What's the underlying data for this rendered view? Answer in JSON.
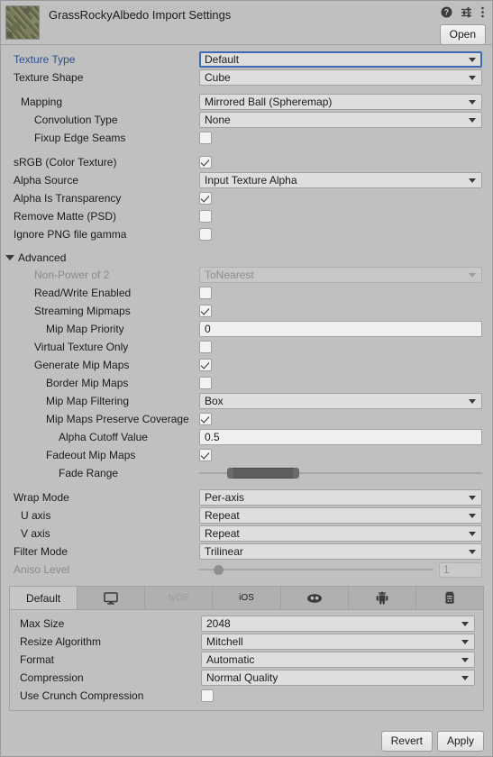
{
  "header": {
    "title": "GrassRockyAlbedo Import Settings",
    "thumbnail_alt": "grass-rocky-albedo-texture",
    "open_label": "Open",
    "icons": [
      "help-icon",
      "preset-icon",
      "more-menu-icon"
    ]
  },
  "settings": [
    {
      "label": "Texture Type",
      "indent": 0,
      "type": "dropdown",
      "value": "Default",
      "focused": true
    },
    {
      "label": "Texture Shape",
      "indent": 0,
      "type": "dropdown",
      "value": "Cube"
    },
    {
      "label": "Mapping",
      "indent": 1,
      "type": "dropdown",
      "value": "Mirrored Ball (Spheremap)",
      "gap": true
    },
    {
      "label": "Convolution Type",
      "indent": 2,
      "type": "dropdown",
      "value": "None"
    },
    {
      "label": "Fixup Edge Seams",
      "indent": 2,
      "type": "checkbox",
      "checked": false
    },
    {
      "label": "sRGB (Color Texture)",
      "indent": 0,
      "type": "checkbox",
      "checked": true,
      "gap": true
    },
    {
      "label": "Alpha Source",
      "indent": 0,
      "type": "dropdown",
      "value": "Input Texture Alpha"
    },
    {
      "label": "Alpha Is Transparency",
      "indent": 0,
      "type": "checkbox",
      "checked": true
    },
    {
      "label": "Remove Matte (PSD)",
      "indent": 0,
      "type": "checkbox",
      "checked": false
    },
    {
      "label": "Ignore PNG file gamma",
      "indent": 0,
      "type": "checkbox",
      "checked": false
    }
  ],
  "advanced": {
    "label": "Advanced",
    "expanded": true,
    "items": [
      {
        "label": "Non-Power of 2",
        "indent": 2,
        "type": "dropdown",
        "value": "ToNearest",
        "disabled": true
      },
      {
        "label": "Read/Write Enabled",
        "indent": 2,
        "type": "checkbox",
        "checked": false
      },
      {
        "label": "Streaming Mipmaps",
        "indent": 2,
        "type": "checkbox",
        "checked": true
      },
      {
        "label": "Mip Map Priority",
        "indent": 3,
        "type": "textfield",
        "value": "0"
      },
      {
        "label": "Virtual Texture Only",
        "indent": 2,
        "type": "checkbox",
        "checked": false
      },
      {
        "label": "Generate Mip Maps",
        "indent": 2,
        "type": "checkbox",
        "checked": true
      },
      {
        "label": "Border Mip Maps",
        "indent": 3,
        "type": "checkbox",
        "checked": false
      },
      {
        "label": "Mip Map Filtering",
        "indent": 3,
        "type": "dropdown",
        "value": "Box"
      },
      {
        "label": "Mip Maps Preserve Coverage",
        "indent": 3,
        "type": "checkbox",
        "checked": true
      },
      {
        "label": "Alpha Cutoff Value",
        "indent": 4,
        "type": "textfield",
        "value": "0.5"
      },
      {
        "label": "Fadeout Mip Maps",
        "indent": 3,
        "type": "checkbox",
        "checked": true
      },
      {
        "label": "Fade Range",
        "indent": 4,
        "type": "minmax",
        "min_pct": 11,
        "max_pct": 34
      }
    ]
  },
  "wrapping": [
    {
      "label": "Wrap Mode",
      "indent": 0,
      "type": "dropdown",
      "value": "Per-axis",
      "gap": true
    },
    {
      "label": "U axis",
      "indent": 1,
      "type": "dropdown",
      "value": "Repeat"
    },
    {
      "label": "V axis",
      "indent": 1,
      "type": "dropdown",
      "value": "Repeat"
    },
    {
      "label": "Filter Mode",
      "indent": 0,
      "type": "dropdown",
      "value": "Trilinear"
    },
    {
      "label": "Aniso Level",
      "indent": 0,
      "type": "slider",
      "value": "1",
      "knob_pct": 8,
      "disabled": true
    }
  ],
  "platform": {
    "tabs": [
      {
        "label": "Default",
        "icon": null,
        "selected": true,
        "muted": false
      },
      {
        "label": "",
        "icon": "monitor-icon",
        "selected": false,
        "muted": false
      },
      {
        "label": "tvOS",
        "icon": null,
        "selected": false,
        "muted": true
      },
      {
        "label": "iOS",
        "icon": null,
        "selected": false,
        "muted": false
      },
      {
        "label": "",
        "icon": "visionos-icon",
        "selected": false,
        "muted": false
      },
      {
        "label": "",
        "icon": "android-icon",
        "selected": false,
        "muted": false
      },
      {
        "label": "",
        "icon": "webgl-icon",
        "selected": false,
        "muted": false
      }
    ],
    "settings": [
      {
        "label": "Max Size",
        "type": "dropdown",
        "value": "2048"
      },
      {
        "label": "Resize Algorithm",
        "type": "dropdown",
        "value": "Mitchell"
      },
      {
        "label": "Format",
        "type": "dropdown",
        "value": "Automatic"
      },
      {
        "label": "Compression",
        "type": "dropdown",
        "value": "Normal Quality"
      },
      {
        "label": "Use Crunch Compression",
        "type": "checkbox",
        "checked": false
      }
    ]
  },
  "footer": {
    "revert_label": "Revert",
    "apply_label": "Apply"
  },
  "colors": {
    "panel_bg": "#c0c0c0",
    "field_bg": "#dededc",
    "text": "#1b1b1b",
    "accent_blue": "#2b4f8e",
    "disabled_text": "#8a8a8a"
  }
}
